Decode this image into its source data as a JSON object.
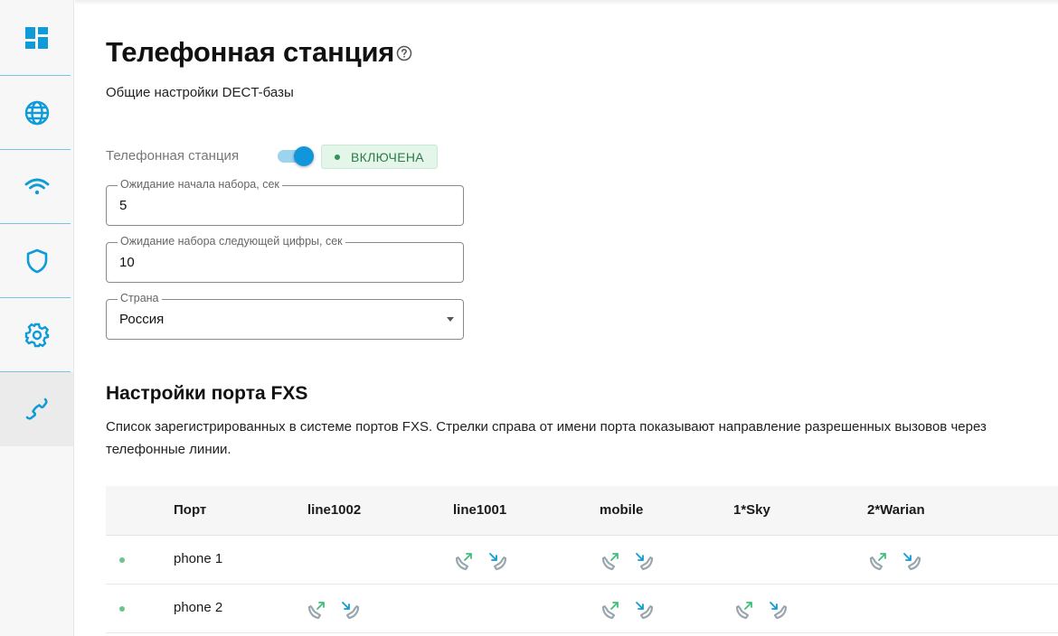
{
  "sidebar": {
    "items": [
      {
        "icon": "dashboard-icon",
        "active": false
      },
      {
        "icon": "globe-icon",
        "active": false
      },
      {
        "icon": "wifi-icon",
        "active": false
      },
      {
        "icon": "shield-icon",
        "active": false
      },
      {
        "icon": "gear-icon",
        "active": false
      },
      {
        "icon": "phone-icon",
        "active": true
      }
    ],
    "accent": "#0e9bd8"
  },
  "header": {
    "title": "Телефонная станция",
    "subtitle": "Общие настройки DECT-базы"
  },
  "station": {
    "label": "Телефонная станция",
    "enabled": true,
    "status": "ВКЛЮЧЕНА"
  },
  "fields": {
    "dial_wait": {
      "label": "Ожидание начала набора, сек",
      "value": "5"
    },
    "digit_wait": {
      "label": "Ожидание набора следующей цифры, сек",
      "value": "10"
    },
    "country": {
      "label": "Страна",
      "value": "Россия"
    }
  },
  "fxs": {
    "title": "Настройки порта FXS",
    "description": "Список зарегистрированных в системе портов FXS. Стрелки справа от имени порта показывают направление разрешенных вызовов через телефонные линии.",
    "columns": [
      "Порт",
      "line1002",
      "line1001",
      "mobile",
      "1*Sky",
      "2*Warian"
    ],
    "rows": [
      {
        "name": "phone 1",
        "lines": [
          false,
          true,
          true,
          false,
          true
        ]
      },
      {
        "name": "phone 2",
        "lines": [
          true,
          false,
          true,
          true,
          false
        ]
      }
    ]
  }
}
